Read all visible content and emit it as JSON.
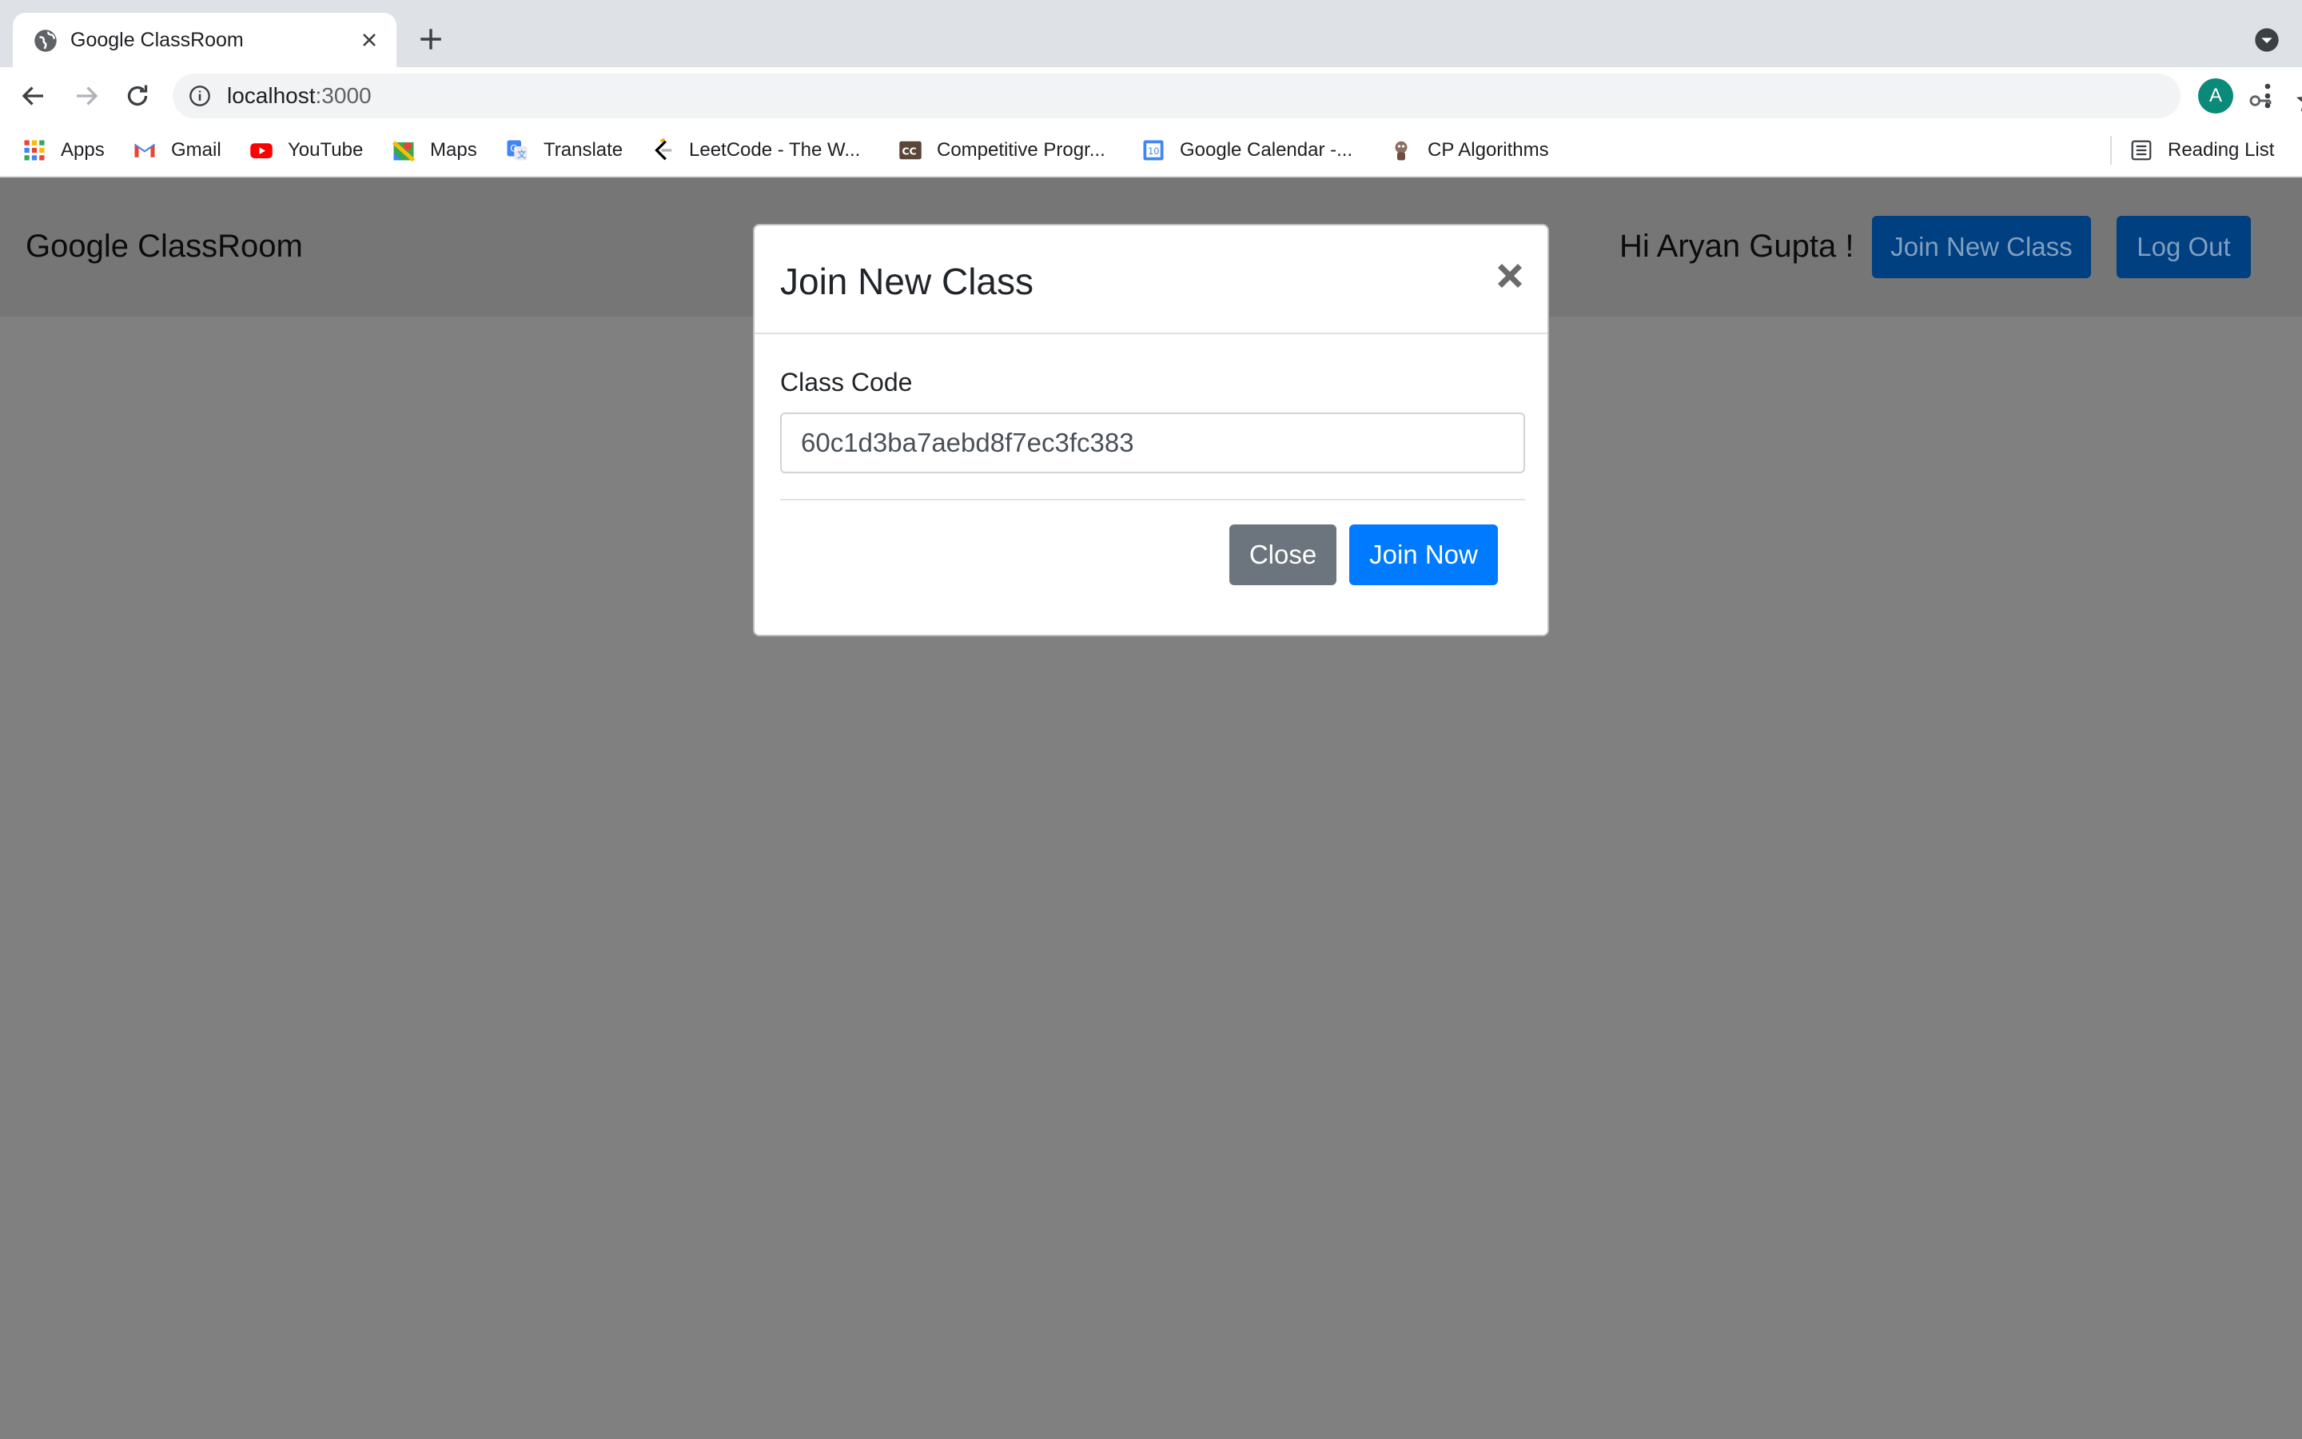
{
  "browser": {
    "tab_title": "Google ClassRoom",
    "url_host": "localhost",
    "url_port": ":3000",
    "profile_initial": "A",
    "bookmarks": [
      {
        "label": "Apps",
        "icon": "apps-grid-icon"
      },
      {
        "label": "Gmail",
        "icon": "gmail-icon"
      },
      {
        "label": "YouTube",
        "icon": "youtube-icon"
      },
      {
        "label": "Maps",
        "icon": "maps-icon"
      },
      {
        "label": "Translate",
        "icon": "translate-icon"
      },
      {
        "label": "LeetCode - The W...",
        "icon": "leetcode-icon"
      },
      {
        "label": "Competitive Progr...",
        "icon": "codechef-icon"
      },
      {
        "label": "Google Calendar -...",
        "icon": "calendar-icon"
      },
      {
        "label": "CP Algorithms",
        "icon": "cp-algorithms-icon"
      }
    ],
    "reading_list": "Reading List"
  },
  "navbar": {
    "brand": "Google ClassRoom",
    "greeting": "Hi Aryan Gupta !",
    "join_button": "Join New Class",
    "logout_button": "Log Out"
  },
  "modal": {
    "title": "Join New Class",
    "field_label": "Class Code",
    "class_code_value": "60c1d3ba7aebd8f7ec3fc383",
    "close_button": "Close",
    "join_button": "Join Now"
  },
  "colors": {
    "primary": "#007bff",
    "secondary": "#6c757d",
    "backdrop": "#808080",
    "avatar": "#0b8a79"
  }
}
